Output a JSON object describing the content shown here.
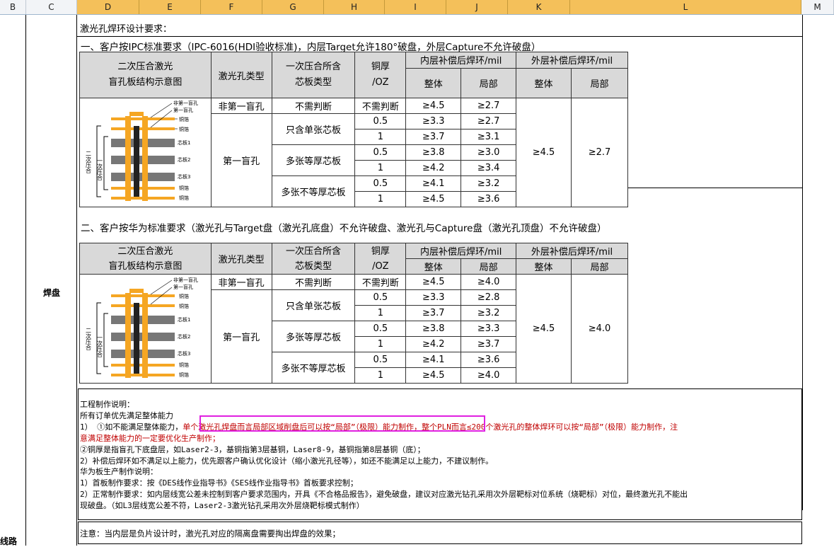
{
  "columns": [
    {
      "label": "B"
    },
    {
      "label": "C"
    },
    {
      "label": "D"
    },
    {
      "label": "E"
    },
    {
      "label": "F"
    },
    {
      "label": "G"
    },
    {
      "label": "H"
    },
    {
      "label": "I"
    },
    {
      "label": "J"
    },
    {
      "label": "K"
    },
    {
      "label": "L"
    },
    {
      "label": "M"
    }
  ],
  "rowlabels": {
    "pad": "焊盘",
    "line": "线路"
  },
  "heading": "激光孔焊环设计要求：",
  "section1": {
    "title": "一、客户按IPC标准要求（IPC-6016(HDI验收标准)，内层Target允许180°破盘，外层Capture不允许破盘）",
    "headers": {
      "diagram": "二次压合激光",
      "diagram2": "盲孔板结构示意图",
      "holetype": "激光孔类型",
      "coretype1": "一次压合所含",
      "coretype2": "芯板类型",
      "cu1": "铜厚",
      "cu2": "/OZ",
      "inner": "内层补偿后焊环/mil",
      "outer": "外层补偿后焊环/mil",
      "whole": "整体",
      "local": "局部"
    },
    "rows": {
      "r0": {
        "type": "非第一盲孔",
        "core": "不需判断",
        "cu": "不需判断",
        "whole": "≥4.5",
        "local": "≥2.7"
      },
      "firsttype": "第一盲孔",
      "core_single": "只含单张芯板",
      "core_multi_eq": "多张等厚芯板",
      "core_multi_neq": "多张不等厚芯板",
      "r1": {
        "cu": "0.5",
        "whole": "≥3.3",
        "local": "≥2.7"
      },
      "r2": {
        "cu": "1",
        "whole": "≥3.7",
        "local": "≥3.1"
      },
      "r3": {
        "cu": "0.5",
        "whole": "≥3.8",
        "local": "≥3.0"
      },
      "r4": {
        "cu": "1",
        "whole": "≥4.2",
        "local": "≥3.4"
      },
      "r5": {
        "cu": "0.5",
        "whole": "≥4.1",
        "local": "≥3.2"
      },
      "r6": {
        "cu": "1",
        "whole": "≥4.5",
        "local": "≥3.6"
      },
      "outer_whole": "≥4.5",
      "outer_local": "≥2.7"
    }
  },
  "section2": {
    "title": "二、客户按华为标准要求（激光孔与Target盘（激光孔底盘）不允许破盘、激光孔与Capture盘（激光孔顶盘）不允许破盘）",
    "rows": {
      "r0": {
        "type": "非第一盲孔",
        "core": "不需判断",
        "cu": "不需判断",
        "whole": "≥4.5",
        "local": "≥4.0"
      },
      "r1": {
        "cu": "0.5",
        "whole": "≥3.3",
        "local": "≥2.8"
      },
      "r2": {
        "cu": "1",
        "whole": "≥3.7",
        "local": "≥3.2"
      },
      "r3": {
        "cu": "0.5",
        "whole": "≥3.8",
        "local": "≥3.3"
      },
      "r4": {
        "cu": "1",
        "whole": "≥4.2",
        "local": "≥3.7"
      },
      "r5": {
        "cu": "0.5",
        "whole": "≥4.1",
        "local": "≥3.6"
      },
      "r6": {
        "cu": "1",
        "whole": "≥4.5",
        "local": "≥4.0"
      },
      "outer_whole": "≥4.5",
      "outer_local": "≥4.0"
    }
  },
  "diagram_labels": {
    "l1": "非第一盲孔",
    "l2": "第一盲孔",
    "l3": "铜箔",
    "l4": "铜箔",
    "l5": "芯板1",
    "l6": "芯板2",
    "l7": "芯板3",
    "l8": "铜箔",
    "l9": "铜箔",
    "b1": "二次压合",
    "b2": "一次压合"
  },
  "notes": {
    "l1": "工程制作说明：",
    "l2": "所有订单优先满足整体能力",
    "l3a": "1）   ①如不能满足整体能力，",
    "l3b": "单个激光孔焊盘而言局部区域削盘后可以按“局部”（极限）能力制作，",
    "l3c": "整个PLN而言≤200个激光孔的整体焊环可以按“局部”（极限）能力制作，注",
    "l4": "意满足整体能力的一定要优化生产制作；",
    "l5": "        ②铜厚是指盲孔下底盘层，如Laser2-3，基铜指第3层基铜，Laser8-9，基铜指第8层基铜（底）；",
    "l6": "2）补偿后焊环如不满足以上能力，优先跟客户确认优化设计（缩小激光孔径等），如还不能满足以上能力，不建议制作。",
    "l7": "华为板生产制作说明：",
    "l8": "1）首板制作要求：按《DES线作业指导书》《SES线作业指导书》首板要求控制；",
    "l9": "2）正常制作要求：如内层线宽公差未控制到客户要求范围内，开具《不合格品报告》，避免破盘，建议对应激光钻孔采用次外层靶标对位系统（烧靶标）对位，最终激光孔不能出",
    "l10": "现破盘。（如L3层线宽公差不符，Laser2-3激光钻孔采用次外层烧靶标模式制作）"
  },
  "note2": "注意：当内层是负片设计时，激光孔对应的隔离盘需要掏出焊盘的效果；",
  "colors": {
    "header_fill": "#d9d9d9",
    "highlight_box": "#e020e0",
    "red_text": "#c00000",
    "selected_col": "#f4c05a"
  }
}
